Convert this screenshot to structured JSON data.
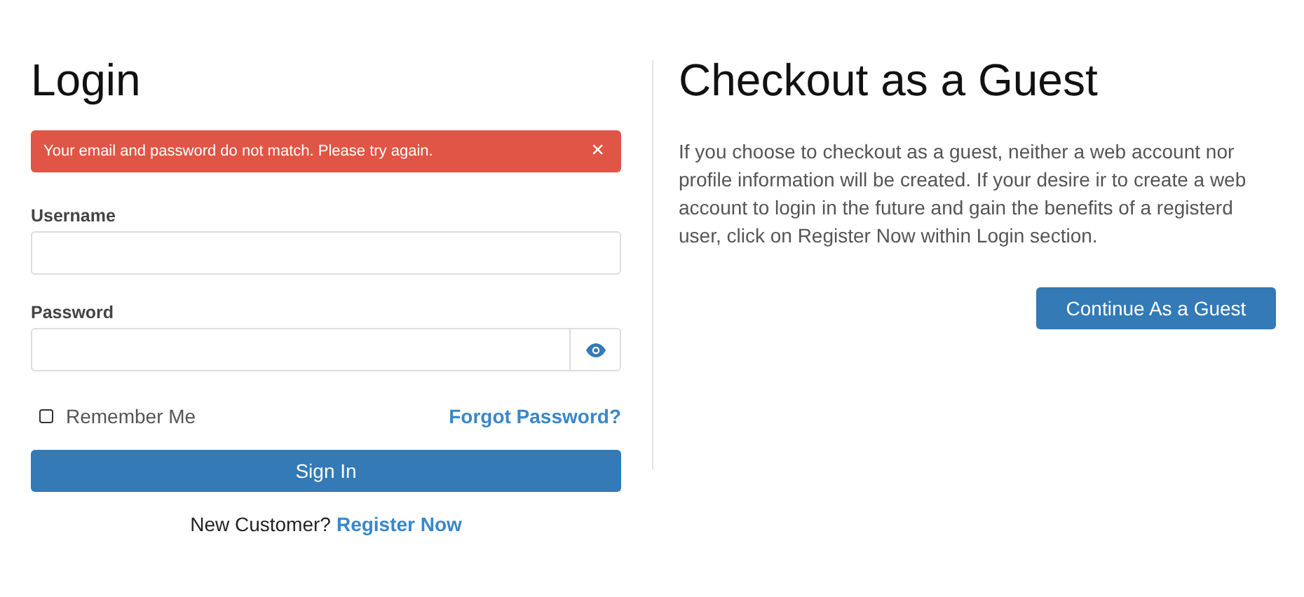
{
  "login": {
    "title": "Login",
    "alert": {
      "message": "Your email and password do not match. Please try again.",
      "close": "×"
    },
    "username": {
      "label": "Username"
    },
    "password": {
      "label": "Password"
    },
    "remember": {
      "label": "Remember Me",
      "checked": false
    },
    "forgot": "Forgot Password?",
    "sign_in": "Sign In",
    "new_customer": {
      "text": "New Customer?",
      "link": "Register Now"
    }
  },
  "guest": {
    "title": "Checkout as a Guest",
    "text": "If you choose to checkout as a guest, neither a web account nor profile information will be created. If your desire ir to create a web account to login in the future and gain the benefits of a registerd user, click on Register Now within Login section.",
    "button": "Continue As a Guest"
  }
}
